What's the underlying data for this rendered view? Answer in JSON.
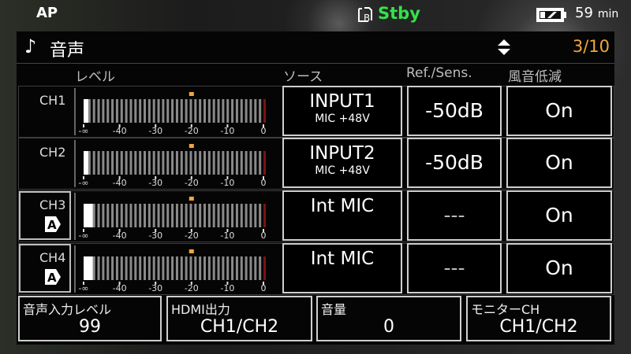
{
  "status": {
    "ap": "AP",
    "media_icon": "media-b-icon",
    "standby": "Stby",
    "battery_icon": "battery-icon",
    "battery_minutes": "59",
    "battery_unit": "min"
  },
  "panel": {
    "icon": "music-note-icon",
    "title": "音声",
    "page": "3/10",
    "page_color": "#f2a83a"
  },
  "columns": {
    "level": "レベル",
    "source": "ソース",
    "ref_sens": "Ref./Sens.",
    "wind": "風音低減"
  },
  "meter_scale": [
    "-∞",
    "-40",
    "-30",
    "-20",
    "-10",
    "0"
  ],
  "channels": [
    {
      "name": "CH1",
      "auto_badge": "",
      "level_fraction": 0.02,
      "source_main": "INPUT1",
      "source_sub": "MIC +48V",
      "ref": "-50dB",
      "wind": "On"
    },
    {
      "name": "CH2",
      "auto_badge": "",
      "level_fraction": 0.02,
      "source_main": "INPUT2",
      "source_sub": "MIC +48V",
      "ref": "-50dB",
      "wind": "On"
    },
    {
      "name": "CH3",
      "auto_badge": "A",
      "level_fraction": 0.05,
      "source_main": "Int MIC",
      "source_sub": "",
      "ref": "---",
      "wind": "On"
    },
    {
      "name": "CH4",
      "auto_badge": "A",
      "level_fraction": 0.05,
      "source_main": "Int MIC",
      "source_sub": "",
      "ref": "---",
      "wind": "On"
    }
  ],
  "bottom": [
    {
      "label": "音声入力レベル",
      "value": "99"
    },
    {
      "label": "HDMI出力",
      "value": "CH1/CH2"
    },
    {
      "label": "音量",
      "value": "0"
    },
    {
      "label": "モニターCH",
      "value": "CH1/CH2"
    }
  ],
  "colors": {
    "standby": "#33e34a",
    "peak_marker": "#f2a83a",
    "over_segment": "#7a1414"
  }
}
